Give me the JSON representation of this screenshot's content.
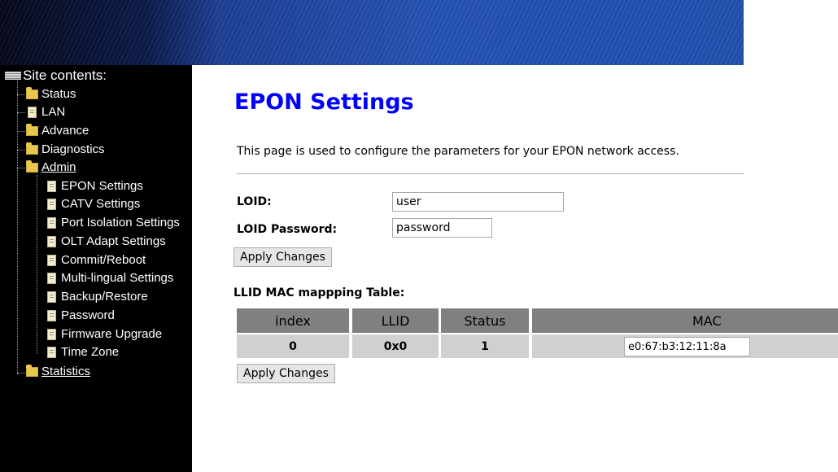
{
  "sidebar": {
    "title": "Site contents:",
    "items": [
      {
        "label": "Status",
        "icon": "folder-icon"
      },
      {
        "label": "LAN",
        "icon": "page-icon"
      },
      {
        "label": "Advance",
        "icon": "folder-icon"
      },
      {
        "label": "Diagnostics",
        "icon": "folder-icon"
      },
      {
        "label": "Admin",
        "icon": "folder-open-icon"
      },
      {
        "label": "EPON Settings",
        "icon": "page-icon"
      },
      {
        "label": "CATV Settings",
        "icon": "page-icon"
      },
      {
        "label": "Port Isolation Settings",
        "icon": "page-icon"
      },
      {
        "label": "OLT Adapt Settings",
        "icon": "page-icon"
      },
      {
        "label": "Commit/Reboot",
        "icon": "page-icon"
      },
      {
        "label": "Multi-lingual Settings",
        "icon": "page-icon"
      },
      {
        "label": "Backup/Restore",
        "icon": "page-icon"
      },
      {
        "label": "Password",
        "icon": "page-icon"
      },
      {
        "label": "Firmware Upgrade",
        "icon": "page-icon"
      },
      {
        "label": "Time Zone",
        "icon": "page-icon"
      },
      {
        "label": "Statistics",
        "icon": "folder-icon"
      }
    ]
  },
  "main": {
    "title": "EPON Settings",
    "description": "This page is used to configure the parameters for your EPON network access.",
    "loid_label": "LOID:",
    "loid_value": "user",
    "loid_password_label": "LOID Password:",
    "loid_password_value": "password",
    "apply_label": "Apply Changes",
    "table_title": "LLID MAC mappping Table:",
    "table": {
      "headers": [
        "index",
        "LLID",
        "Status",
        "MAC"
      ],
      "rows": [
        {
          "index": "0",
          "llid": "0x0",
          "status": "1",
          "mac": "e0:67:b3:12:11:8a"
        }
      ]
    },
    "apply2_label": "Apply Changes"
  },
  "colors": {
    "title": "#0000ff",
    "sidebar_bg": "#000000",
    "banner": "#2452b4",
    "table_header_bg": "#808080",
    "table_cell_bg": "#d0d0d0"
  }
}
